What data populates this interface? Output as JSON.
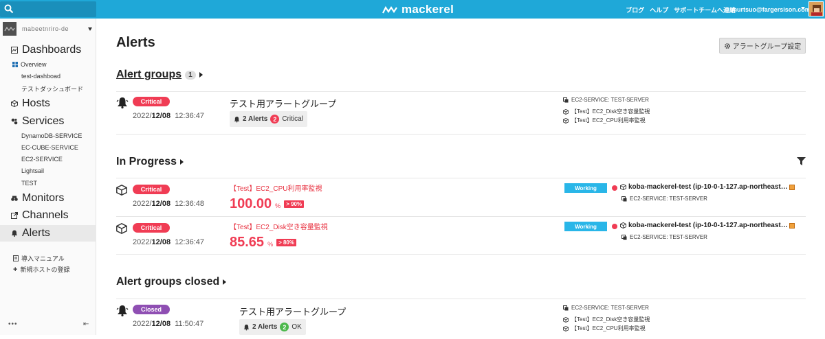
{
  "topbar": {
    "logo_text": "mackerel",
    "links": [
      "ブログ",
      "ヘルプ",
      "サポートチームへ連絡"
    ],
    "user_email": "murtsuo@fargersison.com"
  },
  "sidebar": {
    "org_name": "mabeetnriro-de",
    "items": [
      {
        "label": "Dashboards"
      },
      {
        "label": "Hosts"
      },
      {
        "label": "Services"
      },
      {
        "label": "Monitors"
      },
      {
        "label": "Channels"
      },
      {
        "label": "Alerts"
      }
    ],
    "dashboards_sub": [
      "Overview",
      "test-dashboad",
      "テストダッシュボード"
    ],
    "services_sub": [
      "DynamoDB-SERVICE",
      "EC-CUBE-SERVICE",
      "EC2-SERVICE",
      "Lightsail",
      "TEST"
    ],
    "footer_links": [
      "導入マニュアル",
      "新規ホストの登録"
    ],
    "more": "•••",
    "collapse": "⇤"
  },
  "main": {
    "title": "Alerts",
    "settings_button": "アラートグループ設定",
    "alert_groups": {
      "title": "Alert groups",
      "count": "1",
      "rows": [
        {
          "status": "Critical",
          "date_year": "2022/",
          "date_md": "12/08",
          "time": "12:36:47",
          "name": "テスト用アラートグループ",
          "alerts_label": "2 Alerts",
          "badge_count": "2",
          "badge_label": "Critical",
          "service": "EC2-SERVICE: TEST-SERVER",
          "monitors": [
            "【Test】EC2_Disk空き容量監視",
            "【Test】EC2_CPU利用率監視"
          ]
        }
      ]
    },
    "in_progress": {
      "title": "In Progress",
      "rows": [
        {
          "status": "Critical",
          "monitor": "【Test】EC2_CPU利用率監視",
          "value": "100.00",
          "unit": "%",
          "threshold": "> 90%",
          "date_year": "2022/",
          "date_md": "12/08",
          "time": "12:36:48",
          "working": "Working",
          "host": "koba-mackerel-test (ip-10-0-1-127.ap-northeast…",
          "service": "EC2-SERVICE: TEST-SERVER"
        },
        {
          "status": "Critical",
          "monitor": "【Test】EC2_Disk空き容量監視",
          "value": "85.65",
          "unit": "%",
          "threshold": "> 80%",
          "date_year": "2022/",
          "date_md": "12/08",
          "time": "12:36:47",
          "working": "Working",
          "host": "koba-mackerel-test (ip-10-0-1-127.ap-northeast…",
          "service": "EC2-SERVICE: TEST-SERVER"
        }
      ]
    },
    "closed": {
      "title": "Alert groups closed",
      "rows": [
        {
          "status": "Closed",
          "date_year": "2022/",
          "date_md": "12/08",
          "time": "11:50:47",
          "name": "テスト用アラートグループ",
          "alerts_label": "2 Alerts",
          "badge_count": "2",
          "badge_label": "OK",
          "service": "EC2-SERVICE: TEST-SERVER",
          "monitors": [
            "【Test】EC2_Disk空き容量監視",
            "【Test】EC2_CPU利用率監視"
          ]
        }
      ]
    }
  },
  "colors": {
    "topbar": "#1fa8d8",
    "critical": "#f03c54",
    "closed": "#8f4fb3",
    "working": "#29b6e8",
    "ok": "#4cb84c"
  },
  "icons": [
    "search-icon",
    "mackerel-logo-icon",
    "dashboard-icon",
    "host-icon",
    "services-icon",
    "monitors-icon",
    "channels-icon",
    "alerts-icon",
    "bell-icon",
    "cube-icon",
    "gear-icon",
    "filter-icon",
    "external-link-icon"
  ]
}
